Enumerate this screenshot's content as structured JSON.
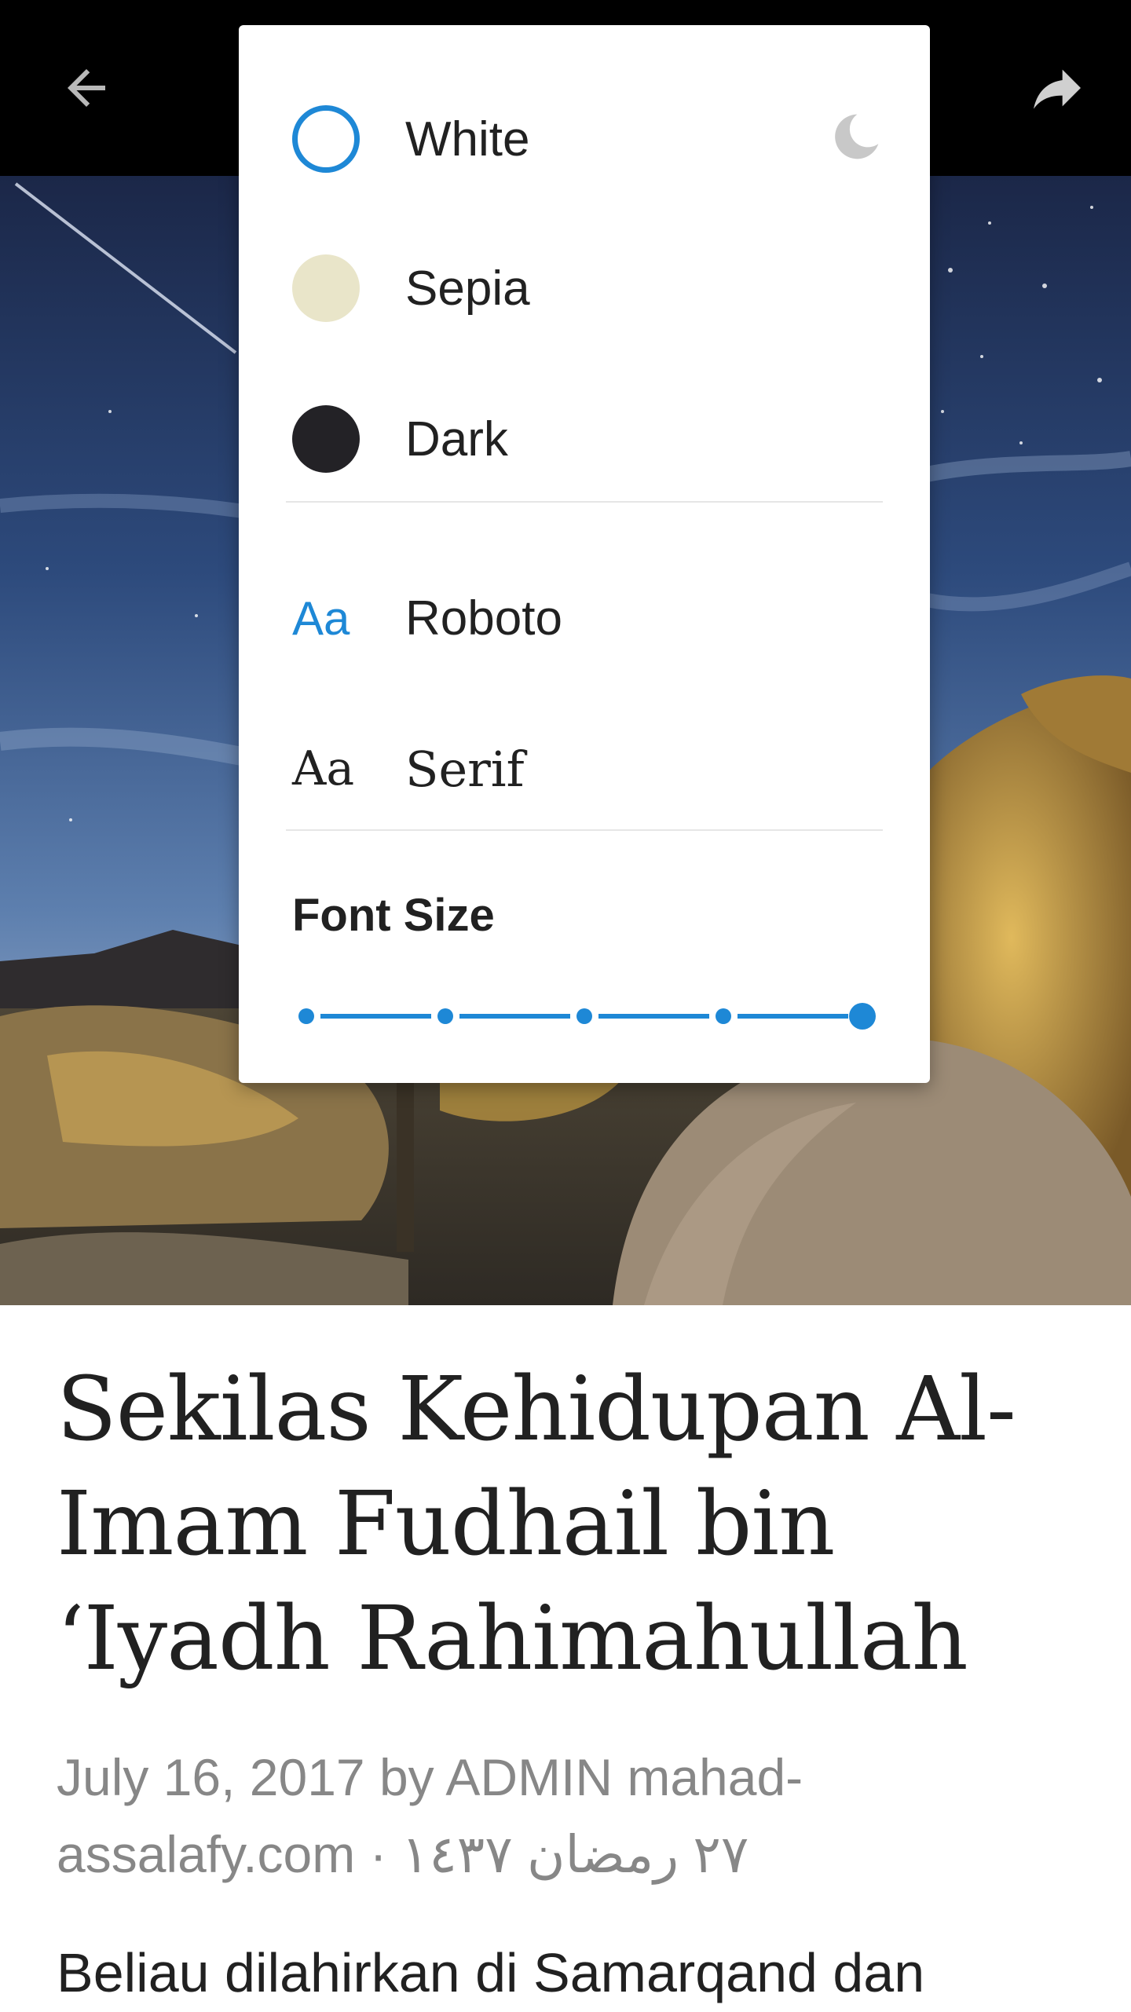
{
  "toolbar": {
    "back_icon": "arrow-left-icon",
    "share_icon": "share-arrow-icon"
  },
  "reader_menu": {
    "themes": [
      {
        "label": "White",
        "swatch": "#ffffff",
        "selected": true
      },
      {
        "label": "Sepia",
        "swatch": "#e9e5c9",
        "selected": false
      },
      {
        "label": "Dark",
        "swatch": "#232226",
        "selected": false
      }
    ],
    "night_icon": "moon-icon",
    "fonts": [
      {
        "sample": "Aa",
        "label": "Roboto",
        "selected": true
      },
      {
        "sample": "Aa",
        "label": "Serif",
        "selected": false
      }
    ],
    "font_size_label": "Font Size",
    "font_size_steps": 5,
    "font_size_selected_index": 4,
    "accent_color": "#1e88d6"
  },
  "article": {
    "title_lines": [
      "Sekilas Kehidupan Al-",
      "Imam Fudhail bin",
      "‘Iyadh Rahimahullah"
    ],
    "meta_line1": "July 16, 2017 by ADMIN mahad-",
    "meta_line2": "assalafy.com · ٢٧ رمضان ١٤٣٧",
    "body_first_line": "Beliau dilahirkan di Samarqand dan"
  }
}
